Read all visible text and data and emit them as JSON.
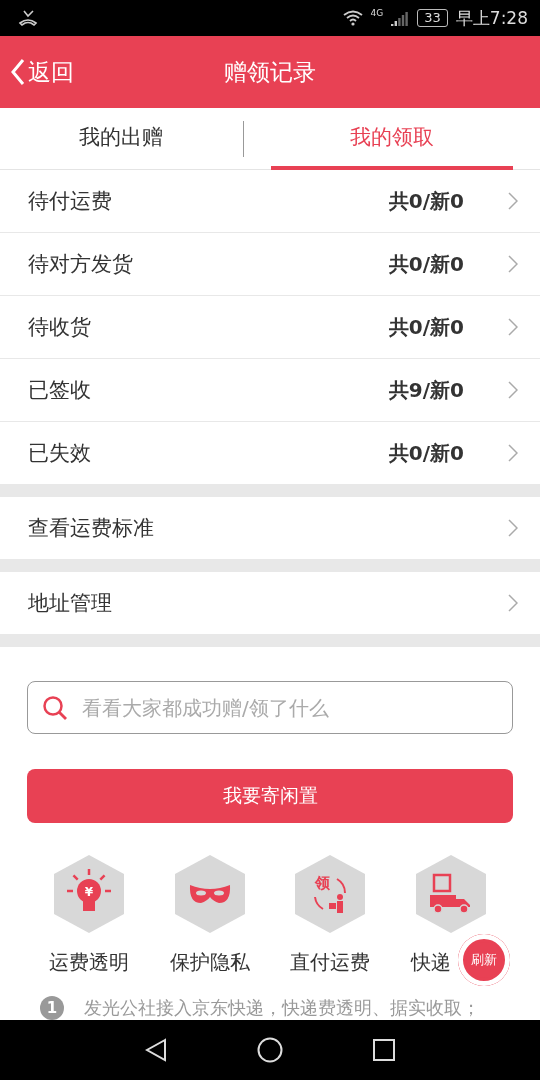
{
  "status_bar": {
    "network": "4G",
    "battery": "33",
    "time": "早上7:28"
  },
  "header": {
    "back": "返回",
    "title": "赠领记录"
  },
  "tabs": [
    {
      "label": "我的出赠",
      "selected": false
    },
    {
      "label": "我的领取",
      "selected": true
    }
  ],
  "records": [
    {
      "label": "待付运费",
      "count": "共0/新0"
    },
    {
      "label": "待对方发货",
      "count": "共0/新0"
    },
    {
      "label": "待收货",
      "count": "共0/新0"
    },
    {
      "label": "已签收",
      "count": "共9/新0"
    },
    {
      "label": "已失效",
      "count": "共0/新0"
    }
  ],
  "links": [
    {
      "label": "查看运费标准"
    },
    {
      "label": "地址管理"
    }
  ],
  "search": {
    "placeholder": "看看大家都成功赠/领了什么"
  },
  "main_button": "我要寄闲置",
  "features": [
    {
      "kind": "bulb",
      "label": "运费透明",
      "icon_text": "¥"
    },
    {
      "kind": "mask",
      "label": "保护隐私"
    },
    {
      "kind": "pay",
      "label": "直付运费",
      "icon_text": "领"
    },
    {
      "kind": "truck",
      "label": "快递"
    }
  ],
  "refresh_button": "刷新",
  "notes": [
    {
      "number": "1",
      "text": "发光公社接入京东快递，快递费透明、据实收取；"
    }
  ]
}
